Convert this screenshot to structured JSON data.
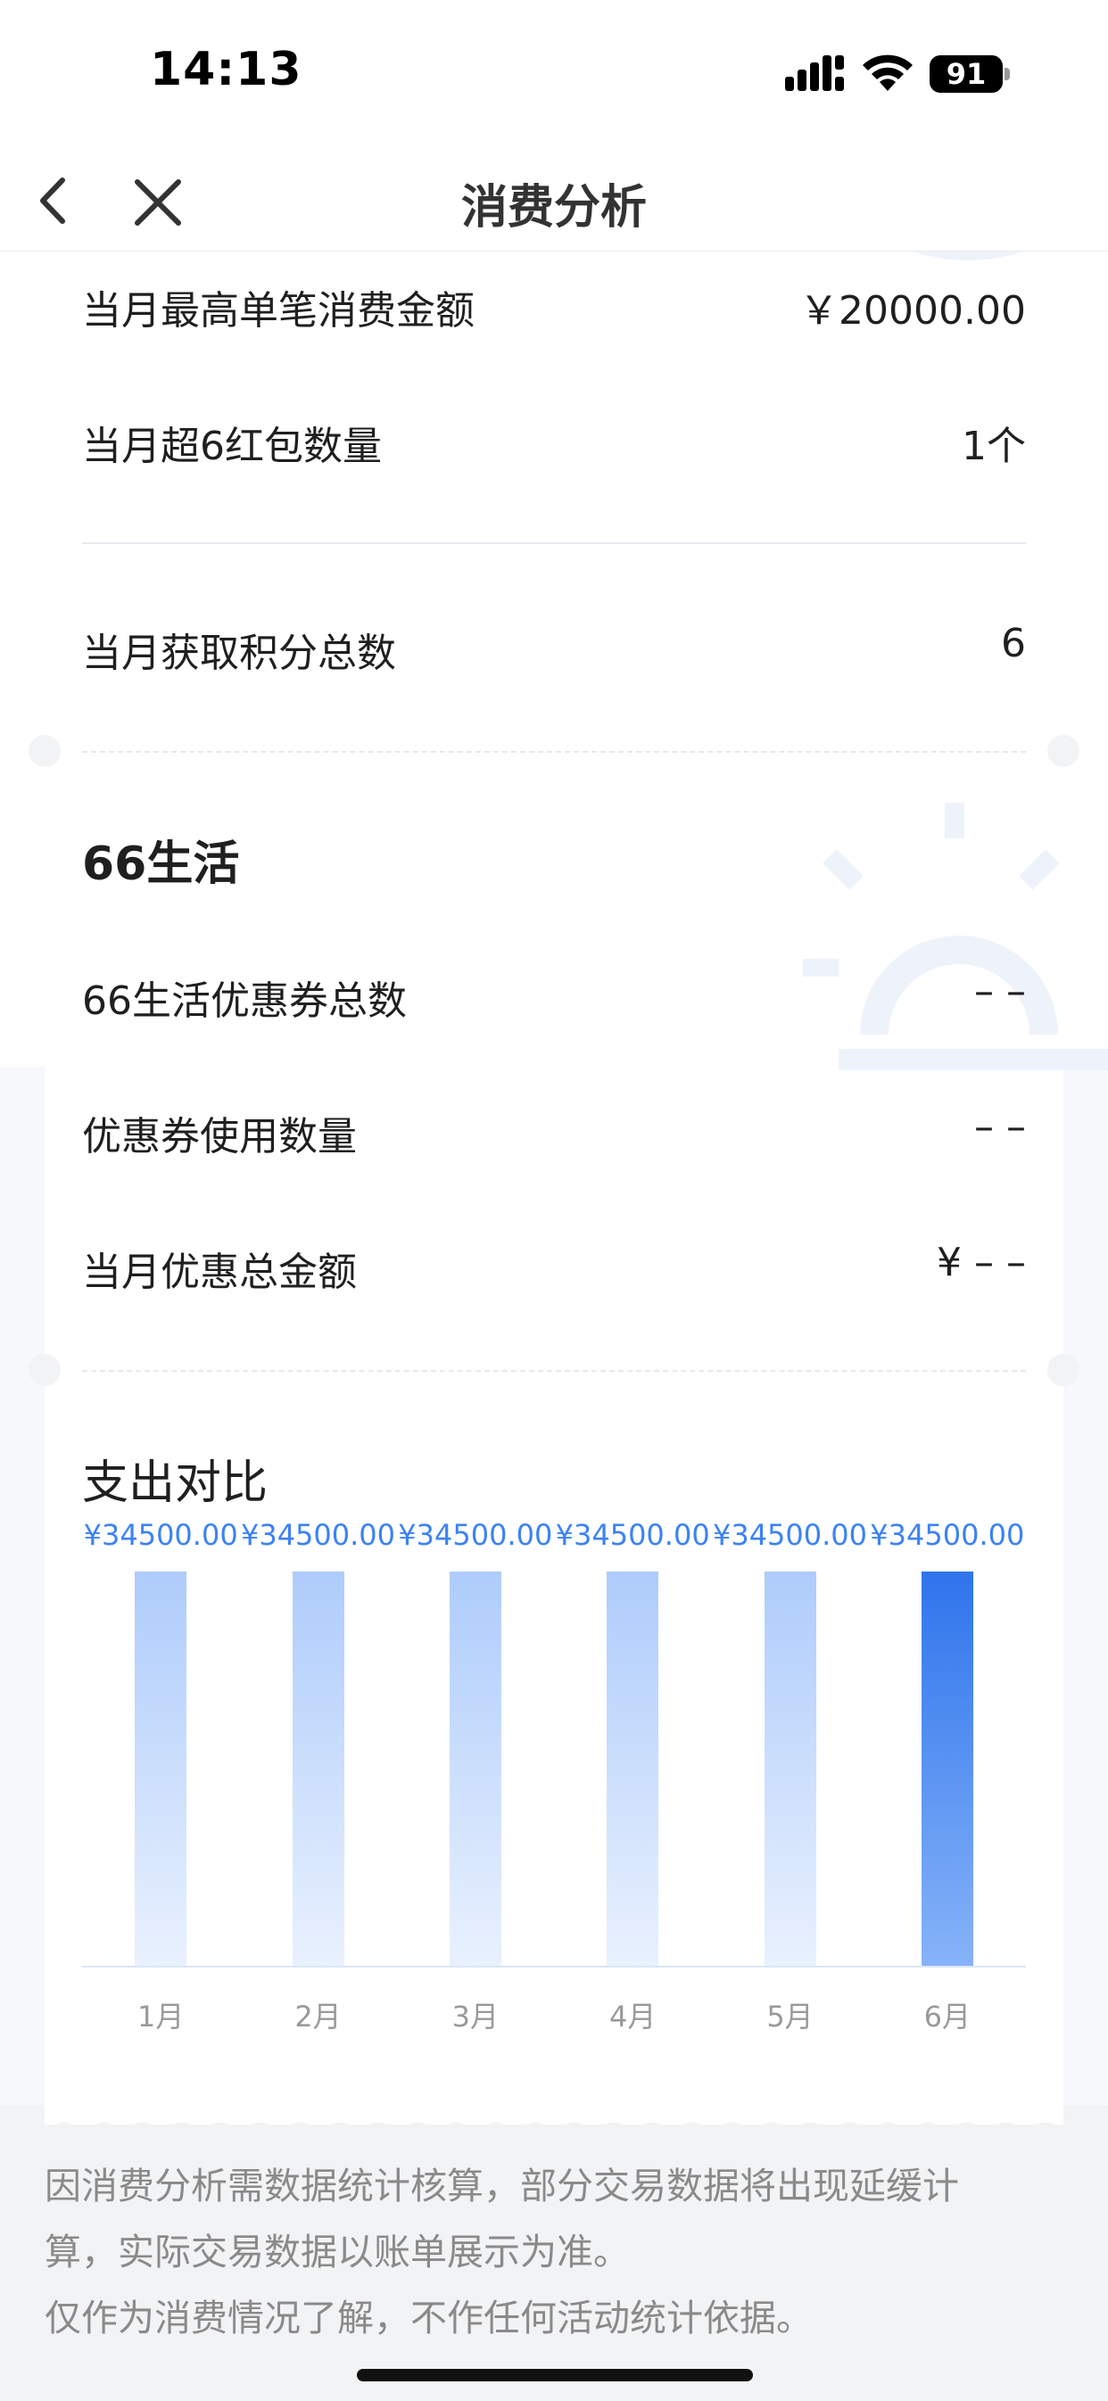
{
  "status_bar": {
    "time": "14:13",
    "battery": "91",
    "icons": [
      "signal-icon",
      "wifi-icon",
      "battery-icon"
    ]
  },
  "nav": {
    "title": "消费分析",
    "icons": [
      "back-icon",
      "close-icon"
    ]
  },
  "stats": [
    {
      "label": "当月最高单笔消费金额",
      "value": "￥20000.00"
    },
    {
      "label": "当月超6红包数量",
      "value": "1个"
    },
    {
      "label": "当月获取积分总数",
      "value": "6"
    }
  ],
  "life66": {
    "title": "66生活",
    "rows": [
      {
        "label": "66生活优惠券总数",
        "value": "– –"
      },
      {
        "label": "优惠券使用数量",
        "value": "– –"
      },
      {
        "label": "当月优惠总金额",
        "value": "¥ – –"
      }
    ]
  },
  "chart_data": {
    "type": "bar",
    "title": "支出对比",
    "categories": [
      "1月",
      "2月",
      "3月",
      "4月",
      "5月",
      "6月"
    ],
    "values": [
      34500,
      34500,
      34500,
      34500,
      34500,
      34500
    ],
    "data_labels": [
      "¥34500.00",
      "¥34500.00",
      "¥34500.00",
      "¥34500.00",
      "¥34500.00",
      "¥34500.00"
    ],
    "highlighted_category": "6月",
    "colors": {
      "bar": "#aeccfb",
      "highlight": "#2f74ec",
      "label": "#3b82f6"
    },
    "grid": false
  },
  "footer": {
    "line1": "因消费分析需数据统计核算，部分交易数据将出现延缓计",
    "line2": "算，实际交易数据以账单展示为准。",
    "line3": "仅作为消费情况了解，不作任何活动统计依据。"
  }
}
